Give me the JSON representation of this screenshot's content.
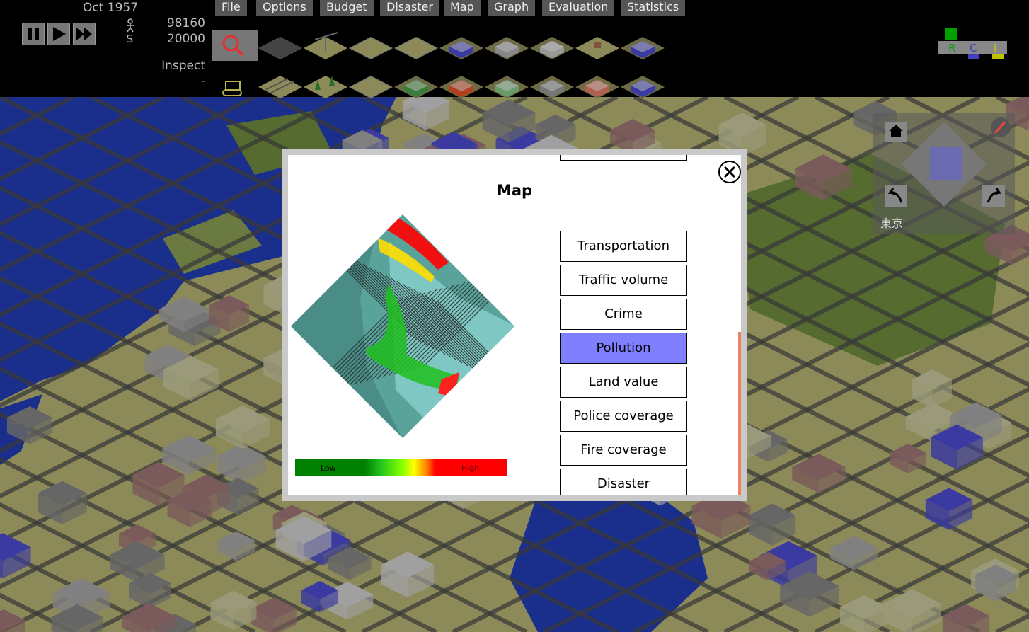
{
  "status": {
    "date": "Oct 1957",
    "population": "98160",
    "funds": "20000",
    "tool_name": "Inspect",
    "tool_cost": "-"
  },
  "menu": [
    "File",
    "Options",
    "Budget",
    "Disaster",
    "Map",
    "Graph",
    "Evaluation",
    "Statistics"
  ],
  "speed_controls": [
    "pause-icon",
    "play-icon",
    "fast-forward-icon"
  ],
  "tools": {
    "row1": [
      "inspect",
      "road",
      "power-line",
      "residential-zone",
      "industrial-zone",
      "police-station",
      "airport",
      "power-plant",
      "house",
      "stadium"
    ],
    "row2": [
      "bulldozer",
      "rail",
      "forest",
      "commercial-zone",
      "park",
      "fire-station",
      "seaport",
      "factory",
      "school",
      "hospital"
    ]
  },
  "rci": {
    "r": "R",
    "c": "C",
    "i": "I",
    "colors": {
      "r": "#00a000",
      "c": "#4040c0",
      "i": "#c0c000"
    }
  },
  "navigator": {
    "city_label": "東京"
  },
  "dialog": {
    "title": "Map",
    "options": [
      "Transportation",
      "Traffic volume",
      "Crime",
      "Pollution",
      "Land value",
      "Police coverage",
      "Fire coverage",
      "Disaster"
    ],
    "selected": "Pollution",
    "legend_low": "Low",
    "legend_high": "High"
  },
  "colors": {
    "water": "#1a2e8c",
    "land": "#8c8a59",
    "accent": "#8080ff"
  }
}
